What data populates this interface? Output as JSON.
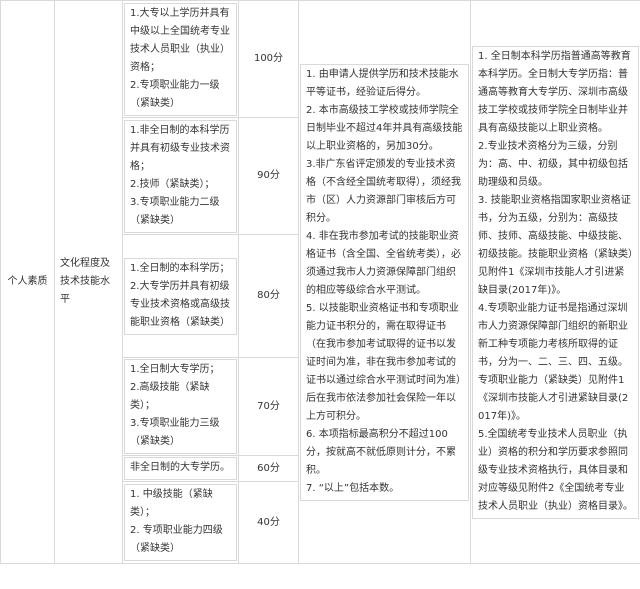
{
  "category": "个人素质",
  "subcategory": "文化程度及技术技能水平",
  "rows": [
    {
      "conditions": [
        "1.大专以上学历并具有中级以上全国统考专业技术人员职业（执业）资格；",
        "2.专项职业能力一级（紧缺类）"
      ],
      "score": "100分"
    },
    {
      "conditions": [
        "1.非全日制的本科学历并具有初级专业技术资格；",
        "2.技师（紧缺类）；",
        "3.专项职业能力二级（紧缺类）"
      ],
      "score": "90分"
    },
    {
      "conditions": [
        "1.全日制的本科学历；",
        "2.大专学历并具有初级专业技术资格或高级技能职业资格（紧缺类）"
      ],
      "score": "80分"
    },
    {
      "conditions": [
        "1.全日制大专学历；",
        "2.高级技能（紧缺类）；",
        "3.专项职业能力三级（紧缺类）"
      ],
      "score": "70分"
    },
    {
      "conditions": [
        "非全日制的大专学历。"
      ],
      "score": "60分"
    },
    {
      "conditions": [
        "1. 中级技能（紧缺类）；",
        "2. 专项职业能力四级（紧缺类）"
      ],
      "score": "40分"
    }
  ],
  "rules": [
    "1. 由申请人提供学历和技术技能水平等证书，经验证后得分。",
    "2. 本市高级技工学校或技师学院全日制毕业不超过4年并具有高级技能以上职业资格的，另加30分。",
    "3.非广东省评定颁发的专业技术资格（不含经全国统考取得），须经我市（区）人力资源部门审核后方可积分。",
    "4. 非在我市参加考试的技能职业资格证书（含全国、全省统考类），必须通过我市人力资源保障部门组织的相应等级综合水平测试。",
    "5. 以技能职业资格证书和专项职业能力证书积分的，需在取得证书（在我市参加考试取得的证书以发证时间为准，非在我市参加考试的证书以通过综合水平测试时间为准）后在我市依法参加社会保险一年以上方可积分。",
    "6. 本项指标最高积分不超过100分，按就高不就低原则计分，不累积。",
    "7. “以上”包括本数。"
  ],
  "notes": [
    "1. 全日制本科学历指普通高等教育本科学历。全日制大专学历指：普通高等教育大专学历、深圳市高级技工学校或技师学院全日制毕业并具有高级技能以上职业资格。",
    "2.专业技术资格分为三级，分别为：高、中、初级，其中初级包括助理级和员级。",
    "3. 技能职业资格指国家职业资格证书，分为五级，分别为：高级技师、技师、高级技能、中级技能、初级技能。技能职业资格（紧缺类）见附件1《深圳市技能人才引进紧缺目录(2017年)》。",
    "4.专项职业能力证书是指通过深圳市人力资源保障部门组织的新职业新工种专项能力考核所取得的证书，分为一、二、三、四、五级。专项职业能力（紧缺类）见附件1《深圳市技能人才引进紧缺目录(2017年)》。",
    "5.全国统考专业技术人员职业（执业）资格的积分和学历要求参照同级专业技术资格执行，具体目录和对应等级见附件2《全国统考专业技术人员职业（执业）资格目录》。"
  ]
}
